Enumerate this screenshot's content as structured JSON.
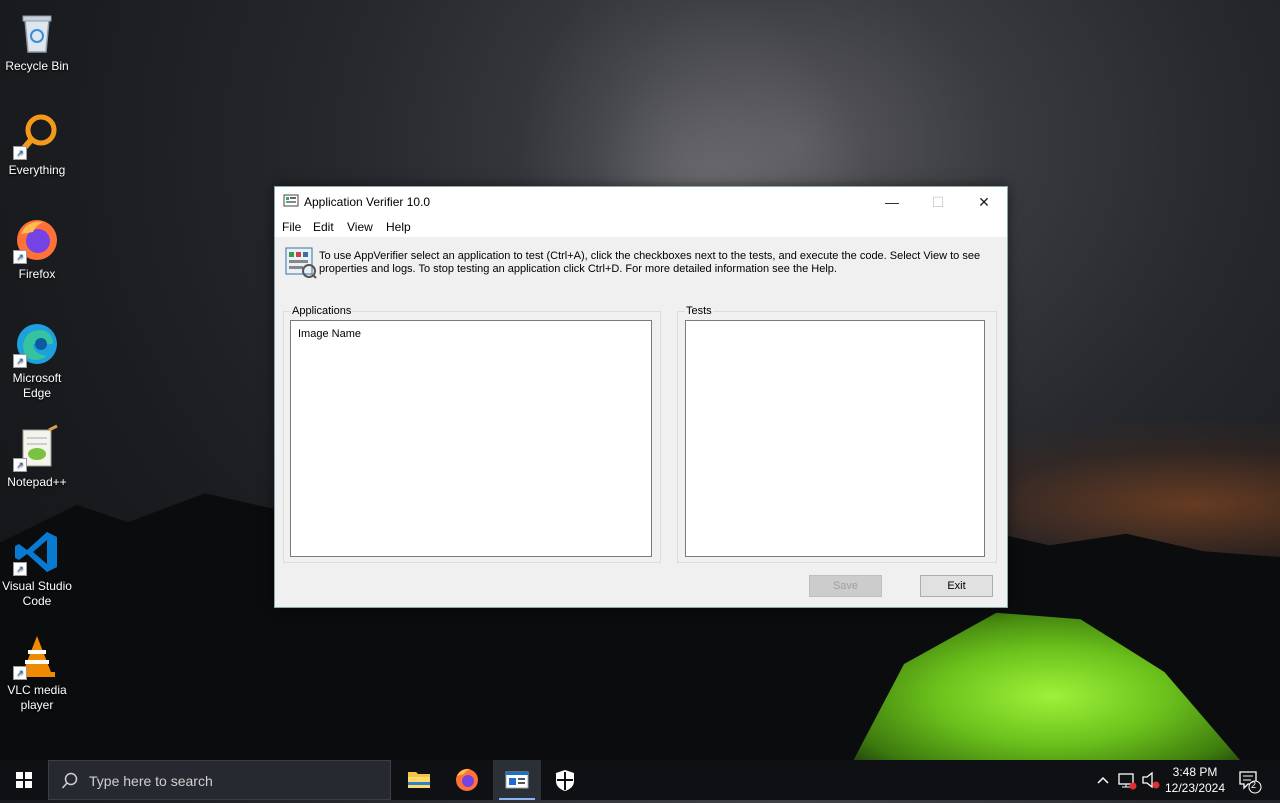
{
  "desktop": {
    "icons": [
      {
        "label": "Recycle Bin",
        "icon": "recycle-bin-icon"
      },
      {
        "label": "Everything",
        "icon": "everything-search-icon"
      },
      {
        "label": "Firefox",
        "icon": "firefox-icon"
      },
      {
        "label": "Microsoft Edge",
        "icon": "edge-icon"
      },
      {
        "label": "Notepad++",
        "icon": "notepadpp-icon"
      },
      {
        "label": "Visual Studio Code",
        "icon": "vscode-icon"
      },
      {
        "label": "VLC media player",
        "icon": "vlc-icon"
      }
    ]
  },
  "window": {
    "title": "Application Verifier 10.0",
    "menu": [
      "File",
      "Edit",
      "View",
      "Help"
    ],
    "info_text": "To use AppVerifier select an application to test (Ctrl+A), click the checkboxes next to the tests, and execute the code. Select View to see properties and logs. To stop testing an application click Ctrl+D. For more detailed information see the Help.",
    "applications": {
      "label": "Applications",
      "column": "Image Name"
    },
    "tests": {
      "label": "Tests"
    },
    "buttons": {
      "save": "Save",
      "exit": "Exit"
    }
  },
  "taskbar": {
    "search_placeholder": "Type here to search",
    "apps": [
      "file-explorer-icon",
      "firefox-icon",
      "app-verifier-icon",
      "windows-security-icon"
    ],
    "time": "3:48 PM",
    "date": "12/23/2024",
    "notification_count": "2"
  },
  "colors": {
    "accent": "#0078d7",
    "taskbar": "#0e1013",
    "window_bg": "#f0f0f0"
  }
}
